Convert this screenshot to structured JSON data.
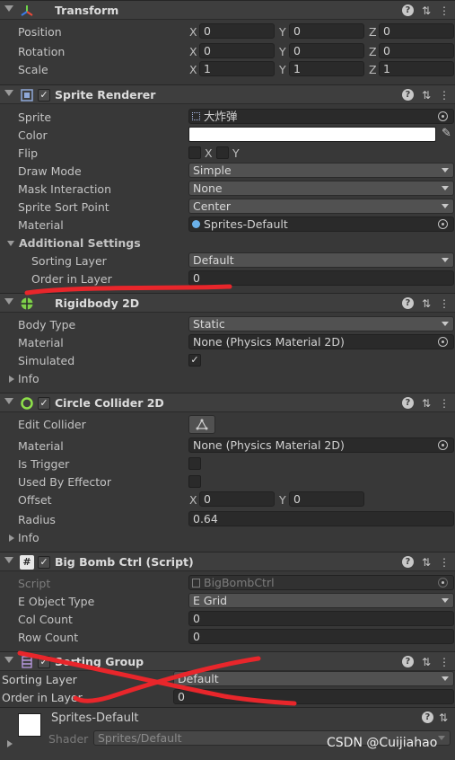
{
  "transform": {
    "title": "Transform",
    "position": {
      "label": "Position",
      "x": "0",
      "y": "0",
      "z": "0"
    },
    "rotation": {
      "label": "Rotation",
      "x": "0",
      "y": "0",
      "z": "0"
    },
    "scale": {
      "label": "Scale",
      "x": "1",
      "y": "1",
      "z": "1"
    },
    "axes": {
      "x": "X",
      "y": "Y",
      "z": "Z"
    }
  },
  "sprite_renderer": {
    "title": "Sprite Renderer",
    "sprite_label": "Sprite",
    "sprite_value": "大炸弹",
    "color_label": "Color",
    "color_value": "#ffffff",
    "flip_label": "Flip",
    "flip_x": "X",
    "flip_y": "Y",
    "draw_mode_label": "Draw Mode",
    "draw_mode_value": "Simple",
    "mask_label": "Mask Interaction",
    "mask_value": "None",
    "sort_point_label": "Sprite Sort Point",
    "sort_point_value": "Center",
    "material_label": "Material",
    "material_value": "Sprites-Default",
    "additional_label": "Additional Settings",
    "sorting_layer_label": "Sorting Layer",
    "sorting_layer_value": "Default",
    "order_label": "Order in Layer",
    "order_value": "0"
  },
  "rigidbody": {
    "title": "Rigidbody 2D",
    "body_type_label": "Body Type",
    "body_type_value": "Static",
    "material_label": "Material",
    "material_value": "None (Physics Material 2D)",
    "simulated_label": "Simulated",
    "simulated_check": "✓",
    "info_label": "Info"
  },
  "circle_collider": {
    "title": "Circle Collider 2D",
    "edit_label": "Edit Collider",
    "material_label": "Material",
    "material_value": "None (Physics Material 2D)",
    "trigger_label": "Is Trigger",
    "effector_label": "Used By Effector",
    "offset_label": "Offset",
    "offset_x": "0",
    "offset_y": "0",
    "radius_label": "Radius",
    "radius_value": "0.64",
    "info_label": "Info"
  },
  "script": {
    "title": "Big Bomb Ctrl (Script)",
    "script_label": "Script",
    "script_value": "BigBombCtrl",
    "object_type_label": "E Object Type",
    "object_type_value": "E Grid",
    "col_label": "Col Count",
    "col_value": "0",
    "row_label": "Row Count",
    "row_value": "0"
  },
  "sorting_group": {
    "title": "Sorting Group",
    "sorting_layer_label": "Sorting Layer",
    "sorting_layer_value": "Default",
    "order_label": "Order in Layer",
    "order_value": "0"
  },
  "material_footer": {
    "name": "Sprites-Default",
    "shader_label": "Shader",
    "shader_value": "Sprites/Default"
  },
  "watermark": "CSDN @Cuijiahao",
  "colors": {
    "annotation_red": "#e8262b",
    "background": "#383838",
    "header": "#3e3e3e"
  }
}
